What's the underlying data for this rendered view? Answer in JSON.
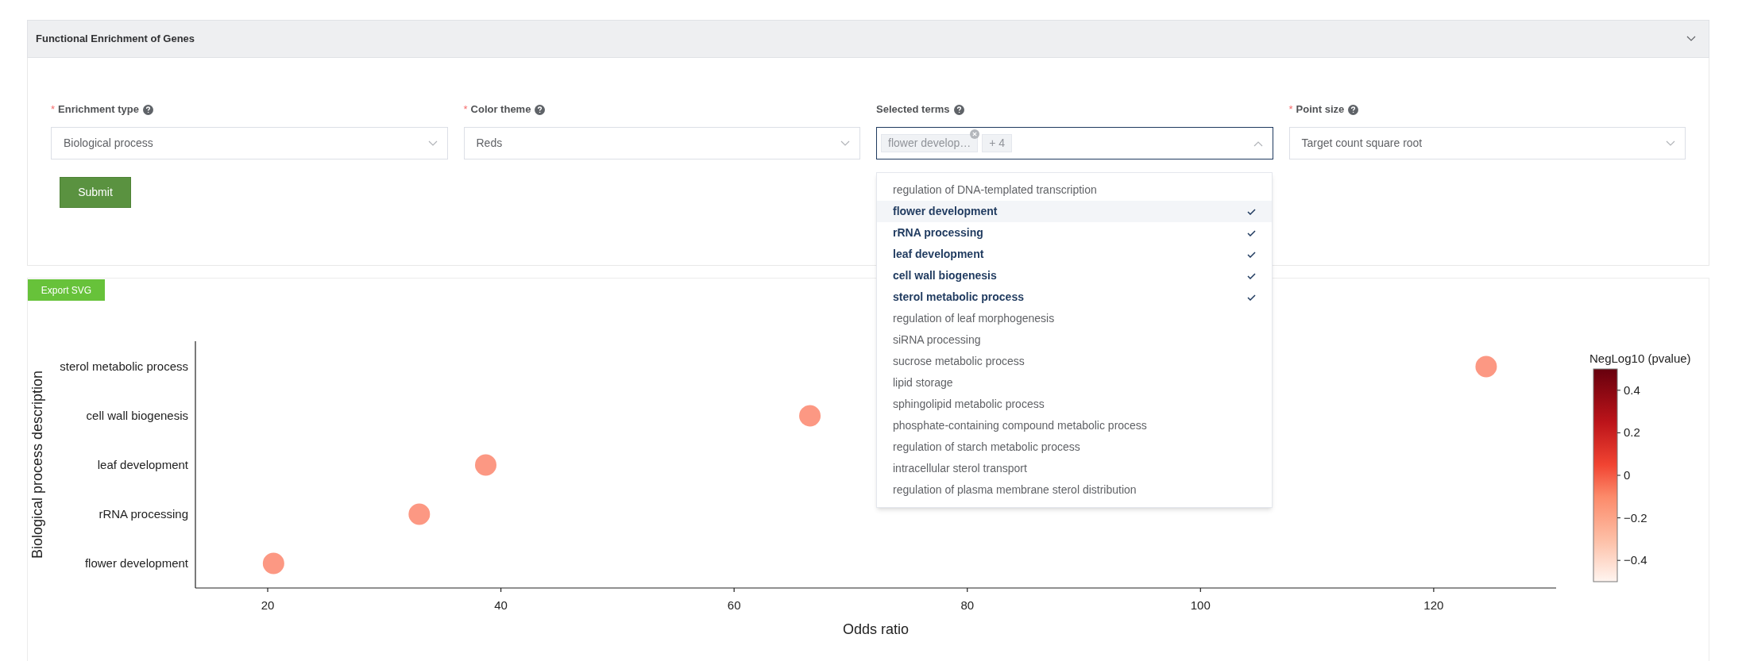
{
  "panel": {
    "title": "Functional Enrichment of Genes",
    "expanded": true
  },
  "form": {
    "fields": [
      {
        "kind": "select",
        "required_mark": "*",
        "label": "Enrichment type",
        "value": "Biological process"
      },
      {
        "kind": "select",
        "required_mark": "*",
        "label": "Color theme",
        "value": "Reds"
      },
      {
        "kind": "multiselect",
        "label": "Selected terms",
        "tags": [
          "flower develop…",
          "+ 4"
        ],
        "open": true
      },
      {
        "kind": "select",
        "required_mark": "*",
        "label": "Point size",
        "value": "Target count square root"
      }
    ],
    "submit": "Submit"
  },
  "dropdown": {
    "options": [
      {
        "label": "regulation of DNA-templated transcription",
        "selected": false,
        "highlighted": false
      },
      {
        "label": "flower development",
        "selected": true,
        "highlighted": true
      },
      {
        "label": "rRNA processing",
        "selected": true,
        "highlighted": false
      },
      {
        "label": "leaf development",
        "selected": true,
        "highlighted": false
      },
      {
        "label": "cell wall biogenesis",
        "selected": true,
        "highlighted": false
      },
      {
        "label": "sterol metabolic process",
        "selected": true,
        "highlighted": false
      },
      {
        "label": "regulation of leaf morphogenesis",
        "selected": false,
        "highlighted": false
      },
      {
        "label": "siRNA processing",
        "selected": false,
        "highlighted": false
      },
      {
        "label": "sucrose metabolic process",
        "selected": false,
        "highlighted": false
      },
      {
        "label": "lipid storage",
        "selected": false,
        "highlighted": false
      },
      {
        "label": "sphingolipid metabolic process",
        "selected": false,
        "highlighted": false
      },
      {
        "label": "phosphate-containing compound metabolic process",
        "selected": false,
        "highlighted": false
      },
      {
        "label": "regulation of starch metabolic process",
        "selected": false,
        "highlighted": false
      },
      {
        "label": "intracellular sterol transport",
        "selected": false,
        "highlighted": false
      },
      {
        "label": "regulation of plasma membrane sterol distribution",
        "selected": false,
        "highlighted": false
      }
    ]
  },
  "plot": {
    "export_button": "Export SVG",
    "chart_data": {
      "type": "scatter",
      "orientation": "horizontal",
      "xlabel": "Odds ratio",
      "ylabel": "Biological process description",
      "categories": [
        "sterol metabolic process",
        "cell wall biogenesis",
        "leaf development",
        "rRNA processing",
        "flower development"
      ],
      "series": [
        {
          "color": "#fc9883",
          "values": [
            124.5,
            66.5,
            38.7,
            33,
            20.5
          ]
        }
      ],
      "xlim": [
        13.8,
        130.5
      ],
      "xticks": [
        20,
        40,
        60,
        80,
        100,
        120
      ]
    },
    "color_scale": {
      "title": "NegLog10 (pvalue)",
      "ticks": [
        "0.4",
        "0.2",
        "0",
        "−0.2",
        "−0.4"
      ]
    }
  }
}
